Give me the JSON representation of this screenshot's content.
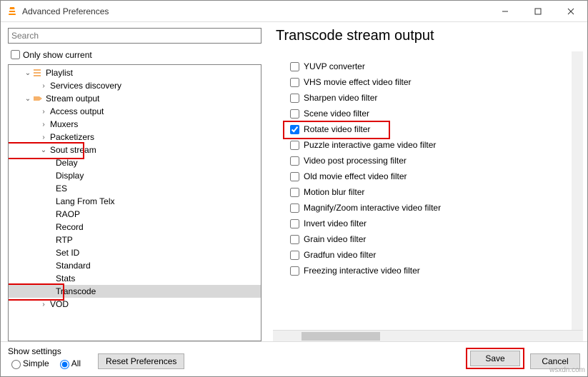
{
  "window": {
    "title": "Advanced Preferences"
  },
  "search": {
    "placeholder": "Search"
  },
  "only_show_current": "Only show current",
  "tree": {
    "playlist": "Playlist",
    "services_discovery": "Services discovery",
    "stream_output": "Stream output",
    "access_output": "Access output",
    "muxers": "Muxers",
    "packetizers": "Packetizers",
    "sout_stream": "Sout stream",
    "delay": "Delay",
    "display": "Display",
    "es": "ES",
    "lang_from_telx": "Lang From Telx",
    "raop": "RAOP",
    "record": "Record",
    "rtp": "RTP",
    "set_id": "Set ID",
    "standard": "Standard",
    "stats": "Stats",
    "transcode": "Transcode",
    "vod": "VOD"
  },
  "heading": "Transcode stream output",
  "filters": {
    "yuvp": "YUVP converter",
    "vhs": "VHS movie effect video filter",
    "sharpen": "Sharpen video filter",
    "scene": "Scene video filter",
    "rotate": "Rotate video filter",
    "puzzle": "Puzzle interactive game video filter",
    "post": "Video post processing filter",
    "oldmovie": "Old movie effect video filter",
    "motion": "Motion blur filter",
    "magnify": "Magnify/Zoom interactive video filter",
    "invert": "Invert video filter",
    "grain": "Grain video filter",
    "gradfun": "Gradfun video filter",
    "freezing": "Freezing interactive video filter"
  },
  "footer": {
    "show_settings": "Show settings",
    "simple": "Simple",
    "all": "All",
    "reset": "Reset Preferences",
    "save": "Save",
    "cancel": "Cancel"
  },
  "watermark": "wsxdn.com"
}
